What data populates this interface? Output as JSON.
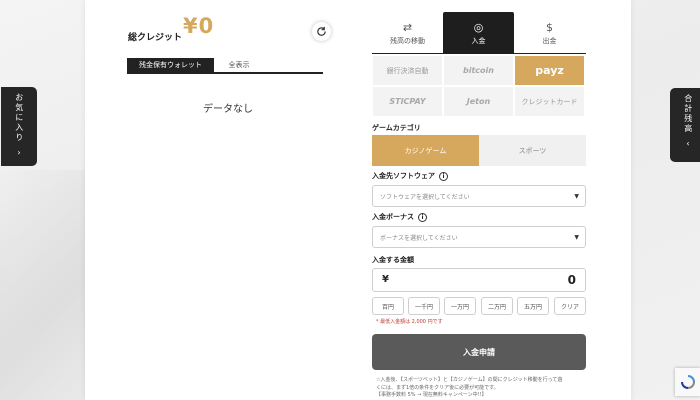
{
  "left_side_tab": {
    "label": "お気に入り",
    "arrow": "›"
  },
  "right_side_tab": {
    "label": "合計残高",
    "arrow": "‹"
  },
  "credit": {
    "title": "総クレジット",
    "amount": "¥0",
    "refresh_icon": "refresh-icon"
  },
  "wallet_tabs": [
    {
      "label": "残金保有ウォレット",
      "active": true
    },
    {
      "label": "全表示",
      "active": false
    }
  ],
  "empty_state": "データなし",
  "action_tabs": [
    {
      "label": "残高の移動",
      "icon": "⇄",
      "active": false
    },
    {
      "label": "入金",
      "icon": "◎",
      "active": true
    },
    {
      "label": "出金",
      "icon": "$",
      "active": false
    }
  ],
  "payment_methods": [
    {
      "label": "銀行決済自動",
      "active": false
    },
    {
      "label": "bitcoin",
      "active": false
    },
    {
      "label": "payz",
      "active": true
    },
    {
      "label": "STICPAY",
      "active": false
    },
    {
      "label": "Jeton",
      "active": false
    },
    {
      "label": "クレジットカード",
      "active": false
    }
  ],
  "game_category": {
    "label": "ゲームカテゴリ",
    "options": [
      {
        "label": "カジノゲーム",
        "active": true
      },
      {
        "label": "スポーツ",
        "active": false
      }
    ]
  },
  "software": {
    "label": "入金先ソフトウェア",
    "placeholder": "ソフトウェアを選択してください"
  },
  "bonus": {
    "label": "入金ボーナス",
    "placeholder": "ボーナスを選択してください"
  },
  "amount": {
    "label": "入金する金額",
    "currency": "¥",
    "value": "0"
  },
  "quick_amounts": [
    "百円",
    "一千円",
    "一万円",
    "二万円",
    "五万円",
    "クリア"
  ],
  "min_note": "* 最低入金額は 2,000 円です",
  "submit_label": "入金申請",
  "footnote_lines": [
    "☆入金後、【スポーツベット】と【カジノゲーム】の間にクレジット移動を行って遊",
    "くには、まず1倍の条件をクリア後に必要が可能です。",
    "【事務手数料 5% → 現在無料キャンペーン中!!】"
  ],
  "colors": {
    "accent": "#d6a85e",
    "dark": "#1e1e1e",
    "submit_bg": "#5a5a5a"
  }
}
